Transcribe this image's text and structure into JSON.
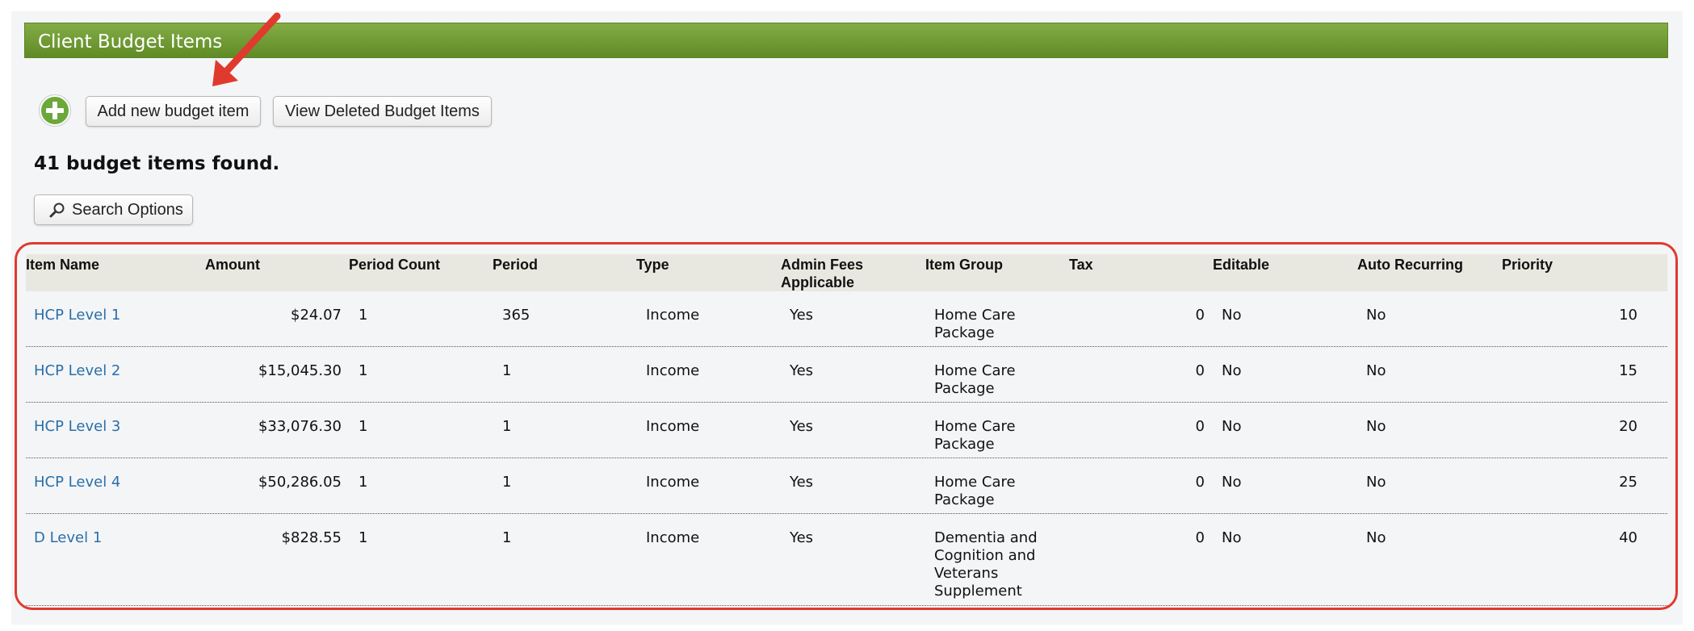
{
  "header": {
    "title": "Client Budget Items"
  },
  "toolbar": {
    "add_label": "Add new budget item",
    "deleted_label": "View Deleted Budget Items"
  },
  "summary": {
    "found_text": "41 budget items found."
  },
  "search": {
    "label": "Search Options"
  },
  "table": {
    "headers": [
      "Item Name",
      "Amount",
      "Period Count",
      "Period",
      "Type",
      "Admin Fees Applicable",
      "Item Group",
      "Tax",
      "Editable",
      "Auto Recurring",
      "Priority"
    ],
    "rows": [
      {
        "name": "HCP Level 1",
        "amount": "$24.07",
        "period_count": "1",
        "period": "365",
        "type": "Income",
        "admin_fees": "Yes",
        "group": "Home Care Package",
        "tax": "0",
        "editable": "No",
        "auto_recurring": "No",
        "priority": "10"
      },
      {
        "name": "HCP Level 2",
        "amount": "$15,045.30",
        "period_count": "1",
        "period": "1",
        "type": "Income",
        "admin_fees": "Yes",
        "group": "Home Care Package",
        "tax": "0",
        "editable": "No",
        "auto_recurring": "No",
        "priority": "15"
      },
      {
        "name": "HCP Level 3",
        "amount": "$33,076.30",
        "period_count": "1",
        "period": "1",
        "type": "Income",
        "admin_fees": "Yes",
        "group": "Home Care Package",
        "tax": "0",
        "editable": "No",
        "auto_recurring": "No",
        "priority": "20"
      },
      {
        "name": "HCP Level 4",
        "amount": "$50,286.05",
        "period_count": "1",
        "period": "1",
        "type": "Income",
        "admin_fees": "Yes",
        "group": "Home Care Package",
        "tax": "0",
        "editable": "No",
        "auto_recurring": "No",
        "priority": "25"
      },
      {
        "name": "D Level 1",
        "amount": "$828.55",
        "period_count": "1",
        "period": "1",
        "type": "Income",
        "admin_fees": "Yes",
        "group": "Dementia and Cognition and Veterans Supplement",
        "tax": "0",
        "editable": "No",
        "auto_recurring": "No",
        "priority": "40"
      }
    ]
  },
  "icons": {
    "add": "plus-circle-icon",
    "search": "magnifier-icon"
  },
  "colors": {
    "header_green": "#6f9a33",
    "link": "#2a6fa8",
    "annotation_red": "#e03a2e"
  }
}
